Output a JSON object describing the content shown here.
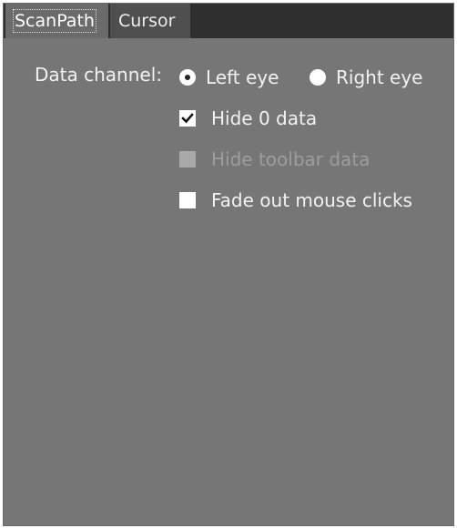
{
  "tabs": [
    {
      "label": "ScanPath",
      "active": true
    },
    {
      "label": "Cursor",
      "active": false
    }
  ],
  "data_channel": {
    "label": "Data channel:",
    "options": [
      {
        "label": "Left eye",
        "selected": true
      },
      {
        "label": "Right eye",
        "selected": false
      }
    ]
  },
  "checkboxes": {
    "hide_zero": {
      "label": "Hide 0 data",
      "checked": true,
      "enabled": true
    },
    "hide_toolbar": {
      "label": "Hide toolbar data",
      "checked": false,
      "enabled": false
    },
    "fade_clicks": {
      "label": "Fade out mouse clicks",
      "checked": false,
      "enabled": true
    }
  },
  "colors": {
    "panel_background": "#767676",
    "tabstrip_background": "#2f2f2f",
    "active_tab": "#6b6b6b",
    "inactive_tab": "#4f4f4f",
    "text": "#f2f2f2",
    "disabled_text": "#9d9d9d"
  },
  "icons": {
    "checkmark": "checkmark-icon"
  }
}
